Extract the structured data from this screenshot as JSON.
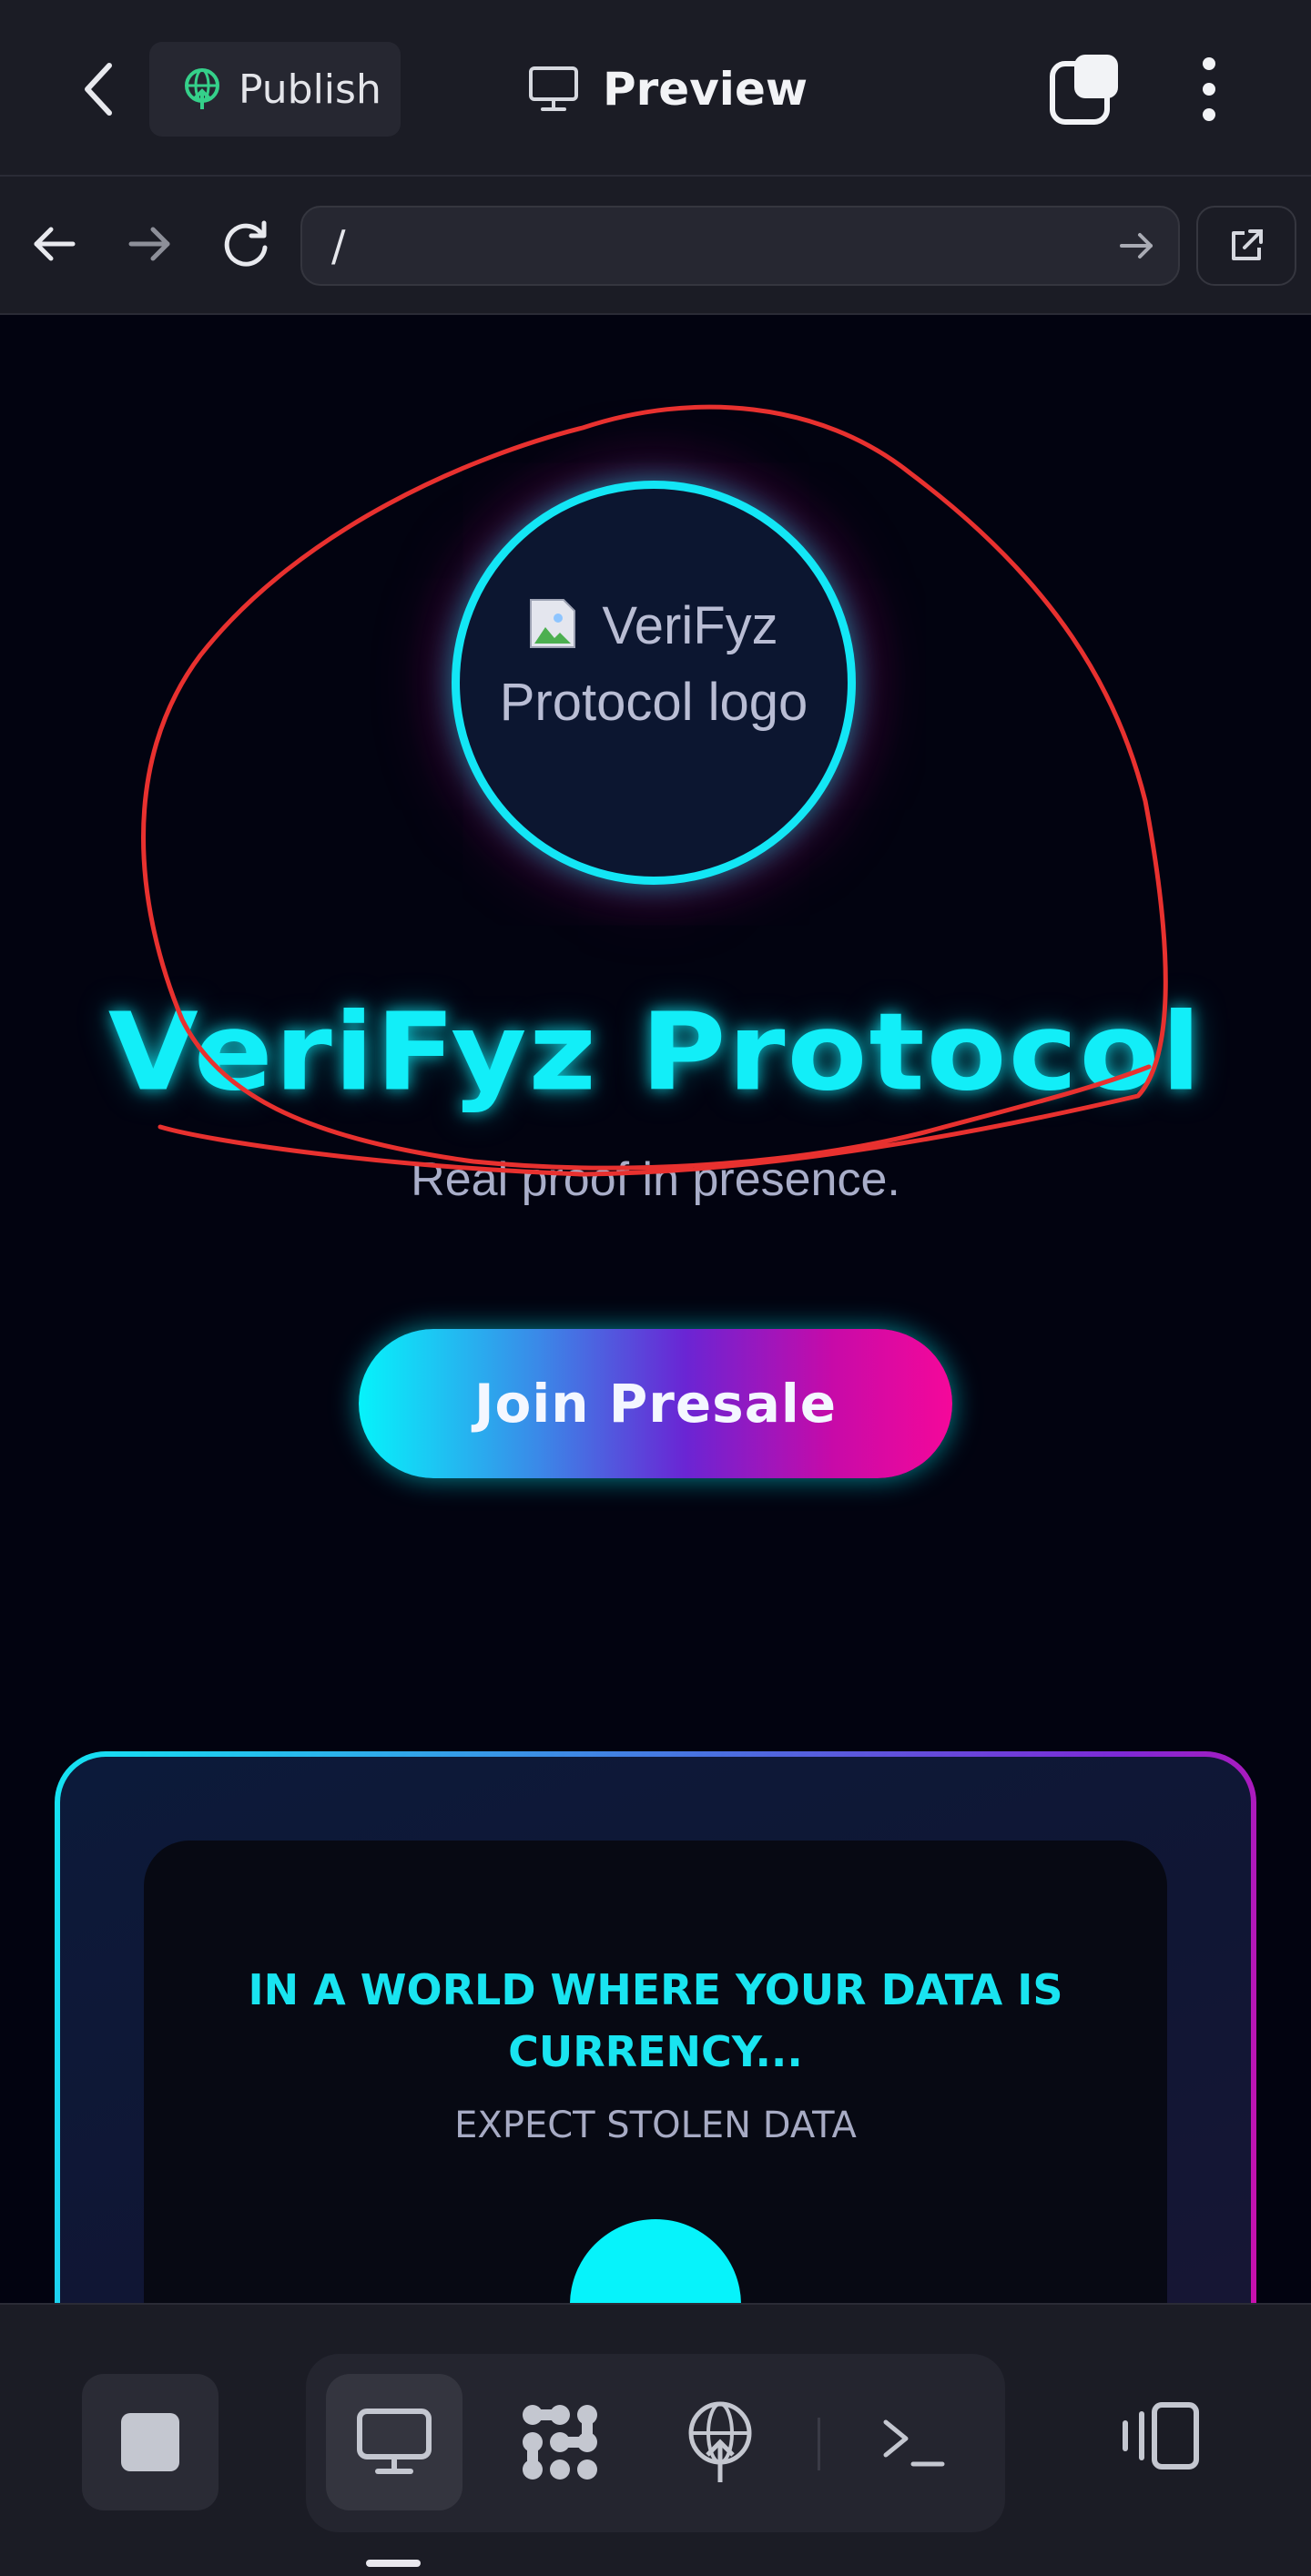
{
  "app_bar": {
    "publish_label": "Publish",
    "preview_label": "Preview",
    "icons": [
      "chevron-left-icon",
      "globe-upload-icon",
      "monitor-icon",
      "tabs-icon",
      "more-vertical-icon"
    ]
  },
  "browser": {
    "url": "/",
    "icons": [
      "arrow-left-icon",
      "arrow-right-icon",
      "refresh-icon",
      "arrow-right-icon",
      "external-link-icon"
    ]
  },
  "hero": {
    "logo_alt": "VeriFyz Protocol logo",
    "title": "VeriFyz Protocol",
    "subtitle": "Real proof in presence.",
    "cta_label": "Join Presale"
  },
  "card": {
    "headline": "IN A WORLD WHERE YOUR DATA IS CURRENCY...",
    "subheading": "EXPECT STOLEN DATA"
  },
  "bottom_toolbar": {
    "icons": [
      "stop-icon",
      "monitor-icon",
      "hub-icon",
      "globe-upload-icon",
      "terminal-icon",
      "devices-icon"
    ]
  },
  "colors": {
    "accent_cyan": "#12eef8",
    "accent_magenta": "#f5089a",
    "accent_purple": "#6a25d4",
    "annotation_red": "#e8312f",
    "page_background": "#020310",
    "chrome_background": "#1b1c25"
  }
}
